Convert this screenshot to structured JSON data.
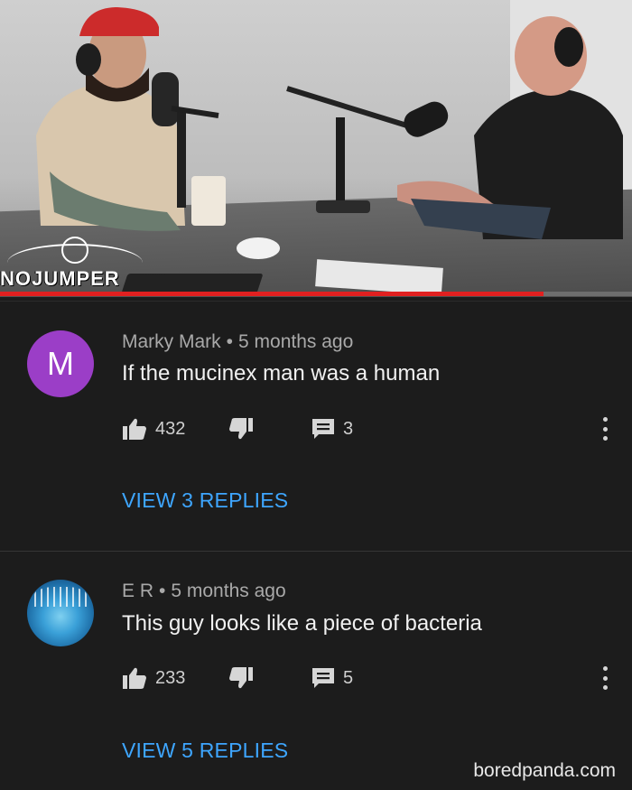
{
  "video": {
    "logo": "NOJUMPER",
    "progress": 0.86,
    "colors": {
      "progress_played": "#e02020",
      "progress_track": "#6e6e6e"
    }
  },
  "comments": [
    {
      "author": "Marky Mark",
      "age": "5 months ago",
      "avatar_letter": "M",
      "avatar_color": "#9b3ec7",
      "text": "If the mucinex man was a human",
      "likes": "432",
      "reply_count": "3",
      "view_replies": "VIEW 3 REPLIES"
    },
    {
      "author": "E R",
      "age": "5 months ago",
      "avatar_letter": "",
      "text": "This guy looks like a piece of bacteria",
      "likes": "233",
      "reply_count": "5",
      "view_replies": "VIEW 5 REPLIES"
    }
  ],
  "separator": "•",
  "icons": [
    "thumbs-up-icon",
    "thumbs-down-icon",
    "reply-icon",
    "more-vert-icon"
  ],
  "accent_color": "#3ea6ff",
  "watermark": "boredpanda.com"
}
